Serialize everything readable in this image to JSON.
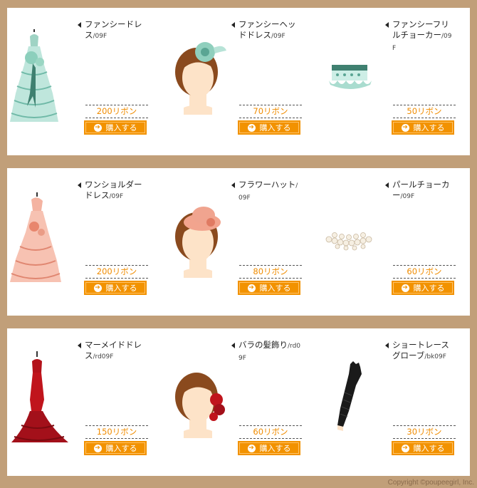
{
  "rows": [
    {
      "items": [
        {
          "name": "ファンシードレス",
          "code": "/09F",
          "price": "200リボン",
          "buy": "購入する",
          "icon": "mint-ball-gown"
        },
        {
          "name": "ファンシーヘッドドレス",
          "code": "/09F",
          "price": "70リボン",
          "buy": "購入する",
          "icon": "mint-headdress"
        },
        {
          "name": "ファンシーフリルチョーカー",
          "code": "/09F",
          "price": "50リボン",
          "buy": "購入する",
          "icon": "mint-frill-choker"
        }
      ]
    },
    {
      "items": [
        {
          "name": "ワンショルダードレス",
          "code": "/09F",
          "price": "200リボン",
          "buy": "購入する",
          "icon": "pink-one-shoulder-dress"
        },
        {
          "name": "フラワーハット",
          "code": "/09F",
          "price": "80リボン",
          "buy": "購入する",
          "icon": "pink-flower-hat"
        },
        {
          "name": "パールチョーカー",
          "code": "/09F",
          "price": "60リボン",
          "buy": "購入する",
          "icon": "pearl-choker"
        }
      ]
    },
    {
      "items": [
        {
          "name": "マーメイドドレス",
          "code": "/rd09F",
          "price": "150リボン",
          "buy": "購入する",
          "icon": "red-mermaid-dress"
        },
        {
          "name": "バラの髪飾り",
          "code": "/rd09F",
          "price": "60リボン",
          "buy": "購入する",
          "icon": "red-rose-hair-ornament"
        },
        {
          "name": "ショートレースグローブ",
          "code": "/bk09F",
          "price": "30リボン",
          "buy": "購入する",
          "icon": "black-lace-glove"
        }
      ]
    }
  ],
  "footer": {
    "copyright": "Copyright ©poupeegirl, Inc."
  },
  "colors": {
    "background": "#c19f79",
    "accent": "#f29200",
    "price": "#f08c00",
    "mint": "#7fc4b4",
    "pink": "#f0a48f",
    "red": "#c0141c"
  }
}
